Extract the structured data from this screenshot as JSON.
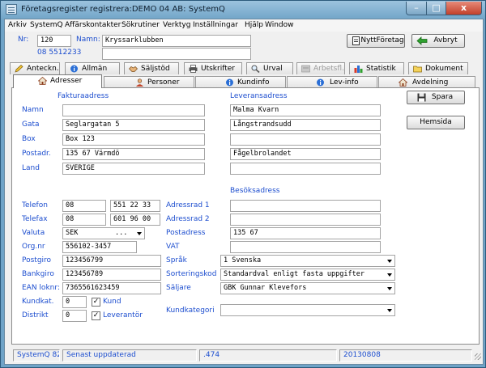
{
  "window": {
    "title": "Företagsregister registrera:DEMO 04 AB: SystemQ",
    "min_glyph": "–",
    "max_glyph": "□",
    "close_glyph": "x"
  },
  "menu": [
    "Arkiv",
    "SystemQ",
    "Affärskontakter",
    "Sökrutiner",
    "Verktyg",
    "Inställningar",
    "Hjälp",
    "Window"
  ],
  "header": {
    "nr_label": "Nr:",
    "nr_value": "120",
    "namn_label": "Namn:",
    "namn_value": "Kryssarklubben",
    "phone": "08 5512233",
    "namn2_value": "",
    "nytt_label": "NyttFöretag",
    "avbryt_label": "Avbryt"
  },
  "tabs_top": [
    "Anteckn.",
    "Allmän",
    "Säljstöd",
    "Utskrifter",
    "Urval",
    "Arbetsfl.",
    "Statistik",
    "Dokument"
  ],
  "tabs_bottom": [
    "Adresser",
    "Personer",
    "Kundinfo",
    "Lev-info",
    "Avdelning"
  ],
  "tabs_active": "Adresser",
  "buttons": {
    "spara": "Spara",
    "hemsida": "Hemsida"
  },
  "faktura": {
    "heading": "Fakturaadress",
    "fields": [
      {
        "label": "Namn",
        "value": ""
      },
      {
        "label": "Gata",
        "value": "Seglargatan 5"
      },
      {
        "label": "Box",
        "value": "Box 123"
      },
      {
        "label": "Postadr.",
        "value": "135 67 Värmdö"
      },
      {
        "label": "Land",
        "value": "SVERIGE"
      }
    ]
  },
  "leverans": {
    "heading": "Leveransadress",
    "fields": [
      "Malma Kvarn",
      "Långstrandsudd",
      "",
      "Fågelbrolandet",
      ""
    ]
  },
  "besok": {
    "heading": "Besöksadress",
    "fields": [
      {
        "label": "Adressrad 1",
        "value": ""
      },
      {
        "label": "Adressrad 2",
        "value": ""
      },
      {
        "label": "Postadress",
        "value": "135 67"
      },
      {
        "label": "VAT",
        "value": ""
      }
    ]
  },
  "contact": {
    "telefon_label": "Telefon",
    "telefon_area": "08",
    "telefon_num": "551 22 33",
    "telefax_label": "Telefax",
    "telefax_area": "08",
    "telefax_num": "601 96 00",
    "valuta_label": "Valuta",
    "valuta_value": "SEK",
    "valuta_dots": "...",
    "orgnr_label": "Org.nr",
    "orgnr_value": "556102-3457",
    "postgiro_label": "Postgiro",
    "postgiro_value": "123456799",
    "bankgiro_label": "Bankgiro",
    "bankgiro_value": "123456789",
    "ean_label": "EAN loknr:",
    "ean_value": "7365561623459",
    "kundkat_label": "Kundkat.",
    "kundkat_value": "0",
    "distrikt_label": "Distrikt",
    "distrikt_value": "0",
    "kund_label": "Kund",
    "kund_checked": "✓",
    "leverantor_label": "Leverantör",
    "leverantor_checked": "✓"
  },
  "selects": {
    "sprak_label": "Språk",
    "sprak_value": "1 Svenska",
    "sortering_label": "Sorteringskod",
    "sortering_value": "Standardval enligt fasta uppgifter",
    "saljare_label": "Säljare",
    "saljare_value": "GBK  Gunnar Klevefors",
    "kundkategori_label": "Kundkategori",
    "kundkategori_value": ""
  },
  "status": {
    "system": "SystemQ 82",
    "updated": "Senast uppdaterad",
    "code": ".474",
    "date": "20130808"
  }
}
